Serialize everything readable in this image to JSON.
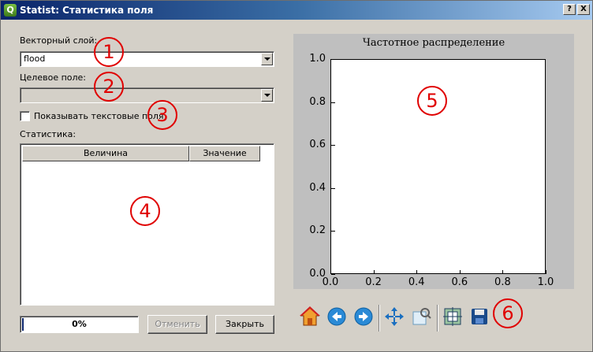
{
  "window": {
    "app_icon": "Q",
    "title": "Statist: Статистика поля",
    "help_button": "?",
    "close_button": "X"
  },
  "form": {
    "vector_layer_label": "Векторный слой:",
    "vector_layer_value": "flood",
    "target_field_label": "Целевое поле:",
    "target_field_value": "",
    "show_text_fields_label": "Показывать текстовые поля",
    "show_text_fields_checked": false,
    "statistics_label": "Статистика:"
  },
  "table": {
    "columns": [
      "Величина",
      "Значение"
    ],
    "rows": []
  },
  "progress": {
    "value": 0,
    "text": "0%"
  },
  "buttons": {
    "cancel": "Отменить",
    "close": "Закрыть"
  },
  "chart_data": {
    "type": "bar",
    "title": "Частотное распределение",
    "xlabel": "",
    "ylabel": "",
    "xlim": [
      0.0,
      1.0
    ],
    "ylim": [
      0.0,
      1.0
    ],
    "x_ticks": [
      "0.0",
      "0.2",
      "0.4",
      "0.6",
      "0.8",
      "1.0"
    ],
    "y_ticks": [
      "0.0",
      "0.2",
      "0.4",
      "0.6",
      "0.8",
      "1.0"
    ],
    "categories": [],
    "values": [],
    "grid": false
  },
  "toolbar": {
    "tools": [
      "home-icon",
      "back-icon",
      "forward-icon",
      "pan-icon",
      "zoom-icon",
      "subplots-icon",
      "save-icon"
    ]
  },
  "annotations": [
    "1",
    "2",
    "3",
    "4",
    "5",
    "6"
  ],
  "colors": {
    "title_bar": "#0a246a",
    "annotation": "#e00000",
    "plot_background": "#bfbfbf"
  }
}
